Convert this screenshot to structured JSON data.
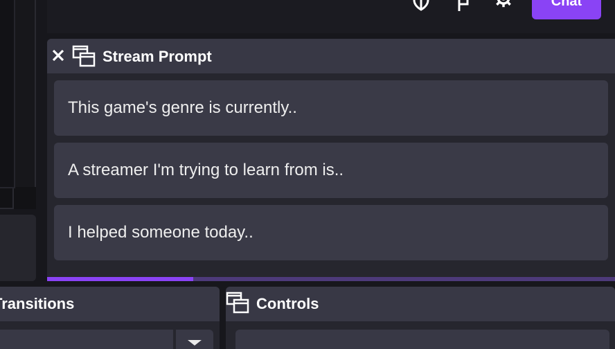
{
  "topbar": {
    "icons": [
      "shield-icon",
      "flag-icon",
      "gear-icon"
    ],
    "chat_label": "Chat"
  },
  "stream_prompt": {
    "title": "Stream Prompt",
    "prompts": [
      "This game's genre is currently..",
      "A streamer I'm trying to learn from is..",
      "I helped someone today.."
    ],
    "progress_fraction": 0.257
  },
  "transitions": {
    "title": "Transitions"
  },
  "controls": {
    "title": "Controls"
  },
  "colors": {
    "accent": "#8a43f5",
    "panel_header": "#383845",
    "panel_bg": "#26262e",
    "prompt_bg": "#3a3a47"
  }
}
